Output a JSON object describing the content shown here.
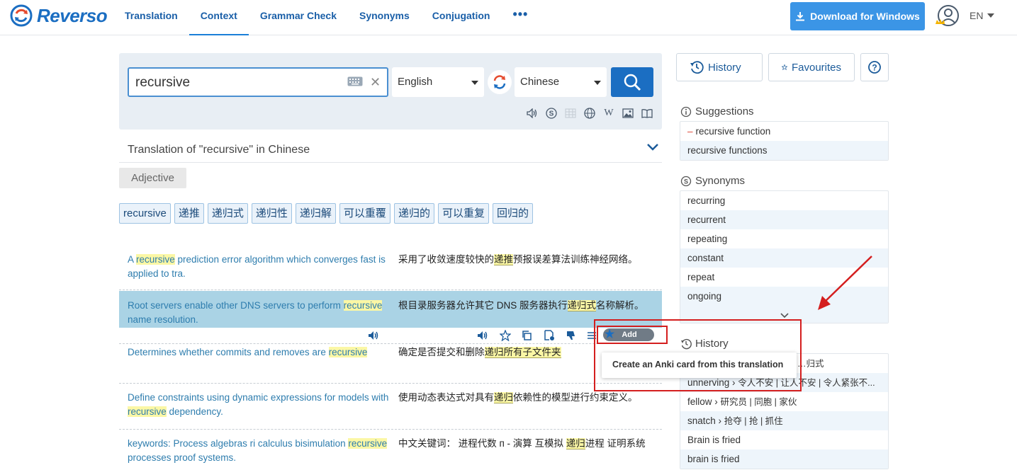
{
  "header": {
    "logo_text": "Reverso",
    "nav": [
      {
        "label": "Translation",
        "active": false
      },
      {
        "label": "Context",
        "active": true
      },
      {
        "label": "Grammar Check",
        "active": false
      },
      {
        "label": "Synonyms",
        "active": false
      },
      {
        "label": "Conjugation",
        "active": false
      }
    ],
    "more_label": "•••",
    "download_label": "Download for Windows",
    "ui_language": "EN"
  },
  "search": {
    "query": "recursive",
    "source_language": "English",
    "target_language": "Chinese"
  },
  "translation": {
    "heading": "Translation of \"recursive\" in Chinese",
    "part_of_speech": "Adjective",
    "chips": [
      "recursive",
      "递推",
      "递归式",
      "递归性",
      "递归解",
      "可以重覆",
      "递归的",
      "可以重复",
      "回归的"
    ]
  },
  "examples": [
    {
      "src_pre": "A ",
      "src_hl": "recursive",
      "src_post": " prediction error algorithm which converges fast is applied to tra.",
      "tgt_pre": "采用了收敛速度较快的",
      "tgt_hl": "递推",
      "tgt_post": "预报误差算法训练神经网络。"
    },
    {
      "src_pre": "Root servers enable other DNS servers to perform ",
      "src_hl": "recursive",
      "src_post": " name resolution.",
      "tgt_pre": "根目录服务器允许其它 DNS 服务器执行",
      "tgt_hl": "递归式",
      "tgt_post": "名称解析。"
    },
    {
      "src_pre": "Determines whether commits and removes are ",
      "src_hl": "recursive",
      "src_post": "",
      "tgt_pre": "确定是否提交和删除",
      "tgt_hl": "递归所有子文件夹",
      "tgt_post": ""
    },
    {
      "src_pre": "Define constraints using dynamic expressions for models with ",
      "src_hl": "recursive",
      "src_post": " dependency.",
      "tgt_pre": "使用动态表达式对具有",
      "tgt_hl": "递归",
      "tgt_post": "依赖性的模型进行约束定义。"
    },
    {
      "src_pre": "keywords: Process algebras ri calculus bisimulation ",
      "src_hl": "recursive",
      "src_post": " processes proof systems.",
      "tgt_pre": "中文关键词： 进程代数 п - 演算 互模拟 ",
      "tgt_hl": "递归",
      "tgt_post": "进程 证明系统"
    }
  ],
  "anki": {
    "button_label": "Add",
    "tooltip": "Create an Anki card from this translation"
  },
  "sidebar": {
    "history_btn": "History",
    "favourites_btn": "Favourites",
    "help_btn": "?",
    "suggestions_title": "Suggestions",
    "suggestions": [
      "recursive function",
      "recursive functions"
    ],
    "synonyms_title": "Synonyms",
    "synonyms": [
      "recurring",
      "recurrent",
      "repeating",
      "constant",
      "repeat",
      "ongoing"
    ],
    "history_title": "History",
    "history": [
      {
        "word": "",
        "trans": "…归式"
      },
      {
        "word": "unnerving",
        "trans": "令人不安 | 让人不安 | 令人紧张不..."
      },
      {
        "word": "fellow",
        "trans": "研究员 | 同胞 | 家伙"
      },
      {
        "word": "snatch",
        "trans": "抢夺 | 抢 | 抓住"
      },
      {
        "word": "Brain is fried",
        "trans": ""
      },
      {
        "word": "brain is fried",
        "trans": ""
      }
    ]
  },
  "colors": {
    "brand": "#1b6ec2",
    "download": "#3b95e6",
    "highlight_row": "#aad3e5",
    "annotation": "#d41e1e"
  }
}
